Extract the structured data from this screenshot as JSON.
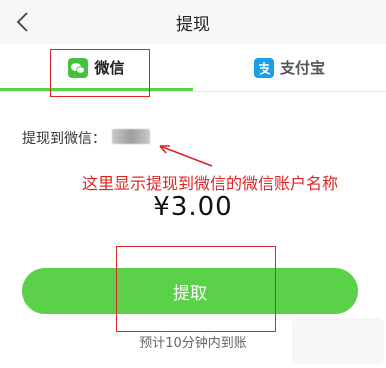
{
  "header": {
    "title": "提现",
    "back_icon": "chevron-left-icon"
  },
  "tabs": [
    {
      "label": "微信",
      "icon": "wechat-icon",
      "active": true
    },
    {
      "label": "支付宝",
      "icon": "alipay-icon",
      "active": false
    }
  ],
  "account": {
    "label": "提现到微信："
  },
  "annotation": {
    "text": "这里显示提现到微信的微信账户名称"
  },
  "amount": {
    "text": "¥3.00"
  },
  "button": {
    "label": "提取"
  },
  "eta": {
    "text": "预计10分钟内到账"
  },
  "colors": {
    "accent": "#5bd14a",
    "annotation": "#e02424",
    "header_bg": "#f7f7f7"
  }
}
